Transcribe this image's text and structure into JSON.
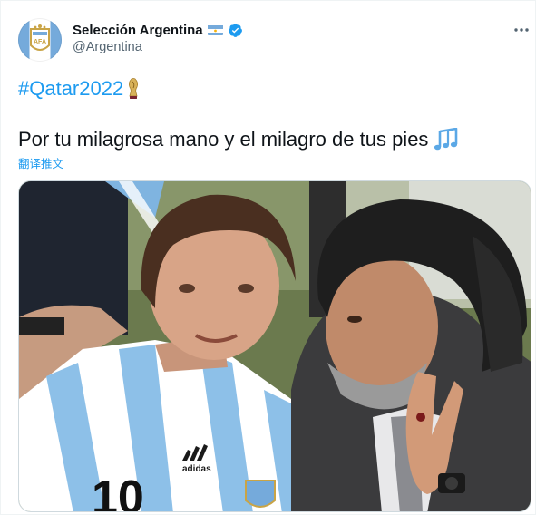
{
  "account": {
    "display_name": "Selección Argentina",
    "handle": "@Argentina",
    "verified": true,
    "flag_icon": "argentina-flag-icon",
    "avatar_icon": "afa-crest-icon"
  },
  "tweet": {
    "hashtag": "#Qatar2022",
    "hashtag_emoji": "world-cup-trophy-icon",
    "text": "Por tu milagrosa mano y el milagro de tus pies",
    "text_emoji": "musical-notes-icon",
    "translate_label": "翻译推文"
  },
  "menu": {
    "icon": "more-icon"
  },
  "media": {
    "description_icon": "photo-two-players-embracing"
  },
  "colors": {
    "link": "#1d9bf0",
    "verified": "#1d9bf0",
    "text": "#0f1419",
    "secondary": "#536471",
    "argentina_blue": "#75aadb"
  }
}
